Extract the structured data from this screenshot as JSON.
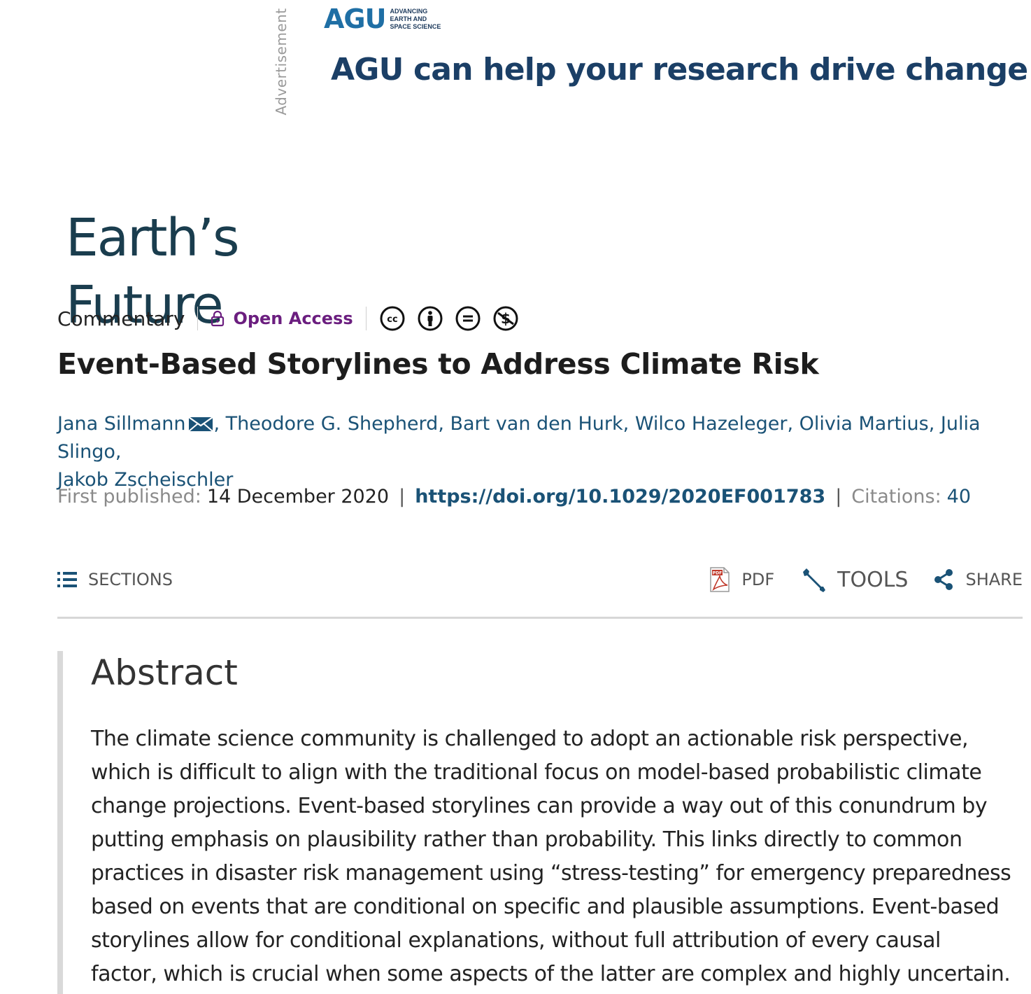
{
  "ad": {
    "label": "Advertisement",
    "brand_mark": "AGU",
    "brand_tagline": [
      "ADVANCING",
      "EARTH AND",
      "SPACE SCIENCE"
    ],
    "headline": "AGU can help your research drive change"
  },
  "journal": {
    "name": "Earth’s Future"
  },
  "article": {
    "type": "Commentary",
    "access": "Open Access",
    "license_icons": [
      "cc-icon",
      "by-icon",
      "nd-icon",
      "nc-icon"
    ],
    "title": "Event-Based Storylines to Address Climate Risk",
    "authors": [
      "Jana Sillmann",
      "Theodore G. Shepherd",
      "Bart van den Hurk",
      "Wilco Hazeleger",
      "Olivia Martius",
      "Julia Slingo",
      "Jakob Zscheischler"
    ],
    "first_published_label": "First published:",
    "first_published": "14 December 2020",
    "doi": "https://doi.org/10.1029/2020EF001783",
    "citations_label": "Citations:",
    "citations": "40"
  },
  "toolbar": {
    "sections": "SECTIONS",
    "pdf": "PDF",
    "tools": "TOOLS",
    "share": "SHARE"
  },
  "abstract": {
    "heading": "Abstract",
    "lines": [
      "The climate science community is challenged to adopt an actionable risk perspective,",
      "which is difficult to align with the traditional focus on model-based probabilistic climate",
      "change projections. Event-based storylines can provide a way out of this conundrum by",
      "putting emphasis on plausibility rather than probability. This links directly to common",
      "practices in disaster risk management using “stress-testing” for emergency preparedness",
      "based on events that are conditional on specific and plausible assumptions. Event-based",
      "storylines allow for conditional explanations, without full attribution of every causal",
      "factor, which is crucial when some aspects of the latter are complex and highly uncertain."
    ]
  },
  "colors": {
    "link": "#1a5276",
    "open_access": "#6b1e7f",
    "journal_logo": "#1a3d4e",
    "ad_headline": "#1b3f66"
  }
}
